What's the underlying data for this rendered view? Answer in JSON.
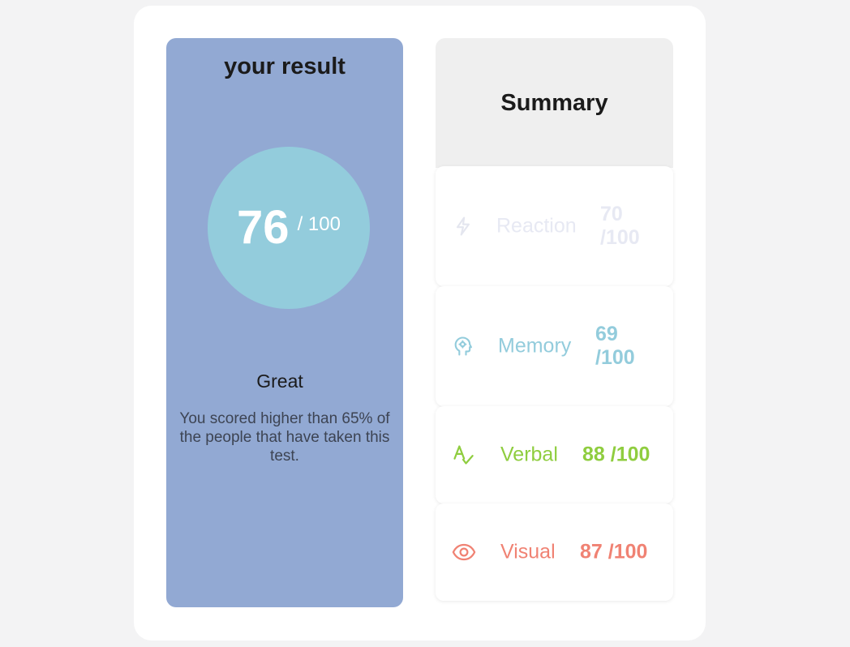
{
  "result": {
    "title": "your result",
    "score": "76",
    "score_max": "/ 100",
    "verdict": "Great",
    "description": "You scored higher than 65% of the people that have taken this test."
  },
  "summary": {
    "title": "Summary",
    "items": [
      {
        "label": "Reaction",
        "score": "70",
        "score_max": "/100",
        "icon": "lightning-bolt-icon",
        "color": "#e7e9f3"
      },
      {
        "label": "Memory",
        "score": "69",
        "score_max": "/100",
        "icon": "brain-head-icon",
        "color": "#93ccdc"
      },
      {
        "label": "Verbal",
        "score": "88 /100",
        "icon": "spell-check-icon",
        "color": "#8fcd3f"
      },
      {
        "label": "Visual",
        "score": "87 /100",
        "icon": "eye-icon",
        "color": "#f08273"
      }
    ]
  },
  "colors": {
    "result_panel": "#92a9d3",
    "score_circle": "#93ccdc",
    "summary_header": "#efefef"
  }
}
